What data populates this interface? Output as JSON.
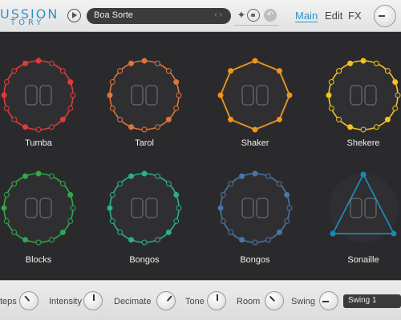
{
  "header": {
    "logo_line1": "USSION",
    "logo_line2": "TORY",
    "preset_name": "Boa Sorte",
    "preset_arrows": "‹›",
    "tabs": [
      "Main",
      "Edit",
      "FX"
    ],
    "active_tab": "Main",
    "accent_color": "#2e93c9"
  },
  "instruments": [
    {
      "name": "Tumba",
      "color": "#e23a3a",
      "shape": "ring",
      "icon": "conga-drums-icon"
    },
    {
      "name": "Tarol",
      "color": "#e0733a",
      "shape": "ring",
      "icon": "snare-drum-icon"
    },
    {
      "name": "Shaker",
      "color": "#f0941c",
      "shape": "octagon",
      "icon": "shaker-icon"
    },
    {
      "name": "Shekere",
      "color": "#f2c31f",
      "shape": "ring",
      "icon": "shekere-icon"
    },
    {
      "name": "Blocks",
      "color": "#2fa84c",
      "shape": "ring",
      "icon": "blocks-sticks-icon"
    },
    {
      "name": "Bongos",
      "color": "#2cae8e",
      "shape": "ring",
      "icon": "bongos-icon"
    },
    {
      "name": "Bongos",
      "color": "#4b76a6",
      "shape": "ring",
      "icon": "bongos-icon"
    },
    {
      "name": "Sonaille",
      "color": "#1d88b4",
      "shape": "triangle",
      "icon": "sonaille-icon"
    }
  ],
  "controls": {
    "steps_label": "teps",
    "intensity_label": "Intensity",
    "decimate_label": "Decimate",
    "tone_label": "Tone",
    "room_label": "Room",
    "swing_label": "Swing",
    "swing_value": "Swing 1"
  }
}
